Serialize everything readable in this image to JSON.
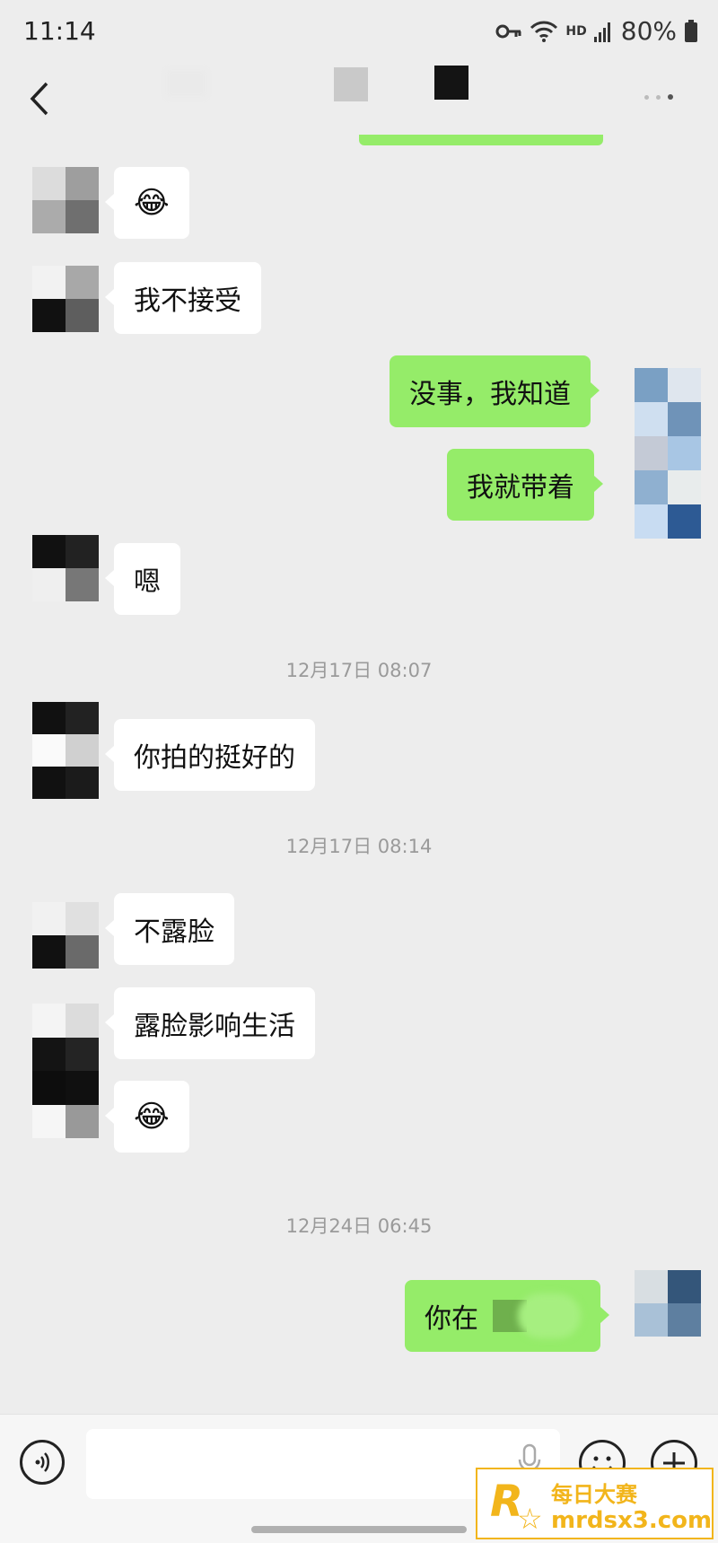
{
  "status_bar": {
    "time": "11:14",
    "hd": "HD",
    "battery": "80%"
  },
  "header": {
    "back_icon": "chevron-left-icon",
    "more_icon": "more-dots-icon"
  },
  "messages": [
    {
      "text": "😂"
    },
    {
      "text": "我不接受"
    },
    {
      "text": "没事，我知道"
    },
    {
      "text": "我就带着"
    },
    {
      "text": "嗯"
    },
    {
      "text": "你拍的挺好的"
    },
    {
      "text": "不露脸"
    },
    {
      "text": "露脸影响生活"
    },
    {
      "text": "😂"
    },
    {
      "text": "你在"
    }
  ],
  "timestamps": [
    "12月17日 08:07",
    "12月17日 08:14",
    "12月24日 06:45"
  ],
  "input_bar": {
    "voice_icon": "voice-icon",
    "mic_icon": "microphone-icon",
    "emoji_icon": "emoji-icon",
    "plus_icon": "plus-icon"
  },
  "watermark": {
    "logo": "R",
    "name": "每日大赛",
    "url": "mrdsx3.com"
  },
  "colors": {
    "background": "#ededed",
    "outgoing_bubble": "#95ec69",
    "incoming_bubble": "#ffffff",
    "watermark": "#f2b51b"
  }
}
